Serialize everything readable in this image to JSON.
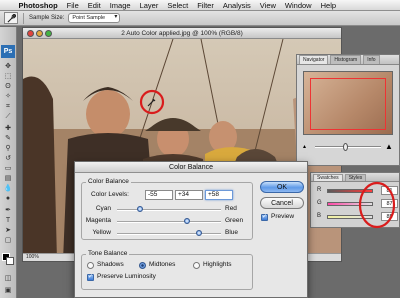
{
  "menubar": {
    "apple": "",
    "items": [
      "Photoshop",
      "File",
      "Edit",
      "Image",
      "Layer",
      "Select",
      "Filter",
      "Analysis",
      "View",
      "Window",
      "Help"
    ]
  },
  "options_bar": {
    "sample_size_label": "Sample Size:",
    "sample_size_value": "Point Sample"
  },
  "tools": {
    "ps_logo": "Ps"
  },
  "document": {
    "title": "2 Auto Color applied.jpg @ 100% (RGB/8)",
    "status_zoom": "100%"
  },
  "navigator": {
    "tabs": [
      "Navigator",
      "Histogram",
      "Info"
    ]
  },
  "color_panel": {
    "tabs": [
      "Swatches",
      "Styles"
    ],
    "rows": [
      {
        "label": "R",
        "value": "81"
      },
      {
        "label": "G",
        "value": "87"
      },
      {
        "label": "B",
        "value": "85"
      }
    ]
  },
  "color_balance": {
    "title": "Color Balance",
    "group_title": "Color Balance",
    "color_levels_label": "Color Levels:",
    "levels": [
      "-55",
      "+34",
      "+58"
    ],
    "sliders": [
      {
        "left": "Cyan",
        "right": "Red",
        "value": -55
      },
      {
        "left": "Magenta",
        "right": "Green",
        "value": 34
      },
      {
        "left": "Yellow",
        "right": "Blue",
        "value": 58
      }
    ],
    "tone_balance_title": "Tone Balance",
    "tones": [
      "Shadows",
      "Midtones",
      "Highlights"
    ],
    "selected_tone": "Midtones",
    "preserve_luminosity_label": "Preserve Luminosity",
    "ok_label": "OK",
    "cancel_label": "Cancel",
    "preview_label": "Preview"
  }
}
